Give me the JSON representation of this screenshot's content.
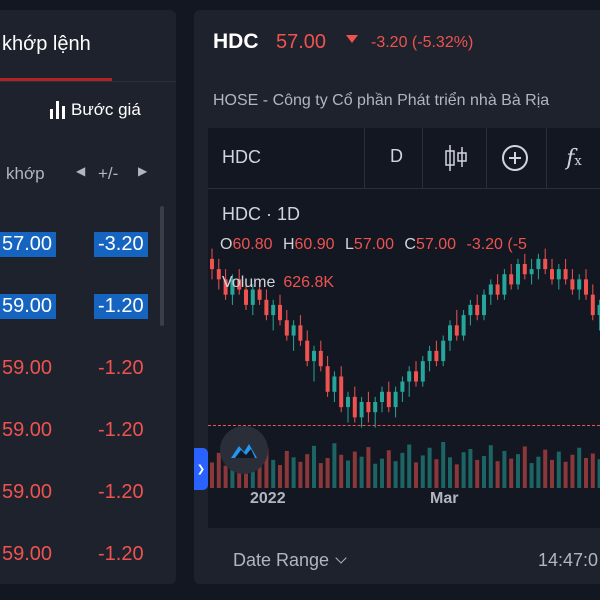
{
  "left_panel": {
    "tab_label": "khớp lệnh",
    "step_button_label": "Bước giá",
    "columns": {
      "matched": "khớp",
      "change": "+/-"
    },
    "rows": [
      {
        "price": "57.00",
        "change": "-3.20",
        "highlight": true
      },
      {
        "price": "59.00",
        "change": "-1.20",
        "highlight": true
      },
      {
        "price": "59.00",
        "change": "-1.20",
        "highlight": false
      },
      {
        "price": "59.00",
        "change": "-1.20",
        "highlight": false
      },
      {
        "price": "59.00",
        "change": "-1.20",
        "highlight": false
      },
      {
        "price": "59.00",
        "change": "-1.20",
        "highlight": false
      }
    ]
  },
  "header": {
    "symbol": "HDC",
    "price": "57.00",
    "change": "-3.20 (-5.32%)",
    "exchange_line": "HOSE - Công ty Cổ phần Phát triển nhà Bà Rịa"
  },
  "chart": {
    "toolbar": {
      "symbol": "HDC",
      "interval": "D"
    },
    "legend_title": "HDC · 1D",
    "ohlc": {
      "o_label": "O",
      "o": "60.80",
      "h_label": "H",
      "h": "60.90",
      "l_label": "L",
      "l": "57.00",
      "c_label": "C",
      "c": "57.00",
      "change": "-3.20 (-5"
    },
    "volume_label": "Volume",
    "volume_value": "626.8K",
    "x_labels": {
      "first": "2022",
      "second": "Mar"
    },
    "footer": {
      "date_range": "Date Range",
      "time": "14:47:0"
    }
  },
  "chart_data": {
    "type": "candlestick",
    "series": [
      {
        "name": "HDC",
        "ohlc": [
          [
            82,
            84,
            78,
            80
          ],
          [
            80,
            82,
            76,
            78
          ],
          [
            78,
            80,
            74,
            75
          ],
          [
            75,
            79,
            73,
            78
          ],
          [
            78,
            80,
            75,
            76
          ],
          [
            76,
            78,
            72,
            73
          ],
          [
            73,
            77,
            71,
            76
          ],
          [
            76,
            78,
            73,
            74
          ],
          [
            74,
            76,
            70,
            71
          ],
          [
            71,
            74,
            68,
            73
          ],
          [
            73,
            75,
            69,
            70
          ],
          [
            70,
            72,
            66,
            67
          ],
          [
            67,
            70,
            64,
            69
          ],
          [
            69,
            71,
            65,
            66
          ],
          [
            66,
            68,
            61,
            62
          ],
          [
            62,
            65,
            58,
            64
          ],
          [
            64,
            66,
            60,
            61
          ],
          [
            61,
            63,
            55,
            56
          ],
          [
            56,
            60,
            54,
            59
          ],
          [
            59,
            61,
            52,
            53
          ],
          [
            53,
            56,
            50,
            55
          ],
          [
            55,
            57,
            50,
            51
          ],
          [
            51,
            55,
            49,
            54
          ],
          [
            54,
            56,
            50,
            52
          ],
          [
            52,
            55,
            49,
            54
          ],
          [
            54,
            57,
            52,
            56
          ],
          [
            56,
            58,
            52,
            53
          ],
          [
            53,
            57,
            51,
            56
          ],
          [
            56,
            59,
            54,
            58
          ],
          [
            58,
            61,
            55,
            60
          ],
          [
            60,
            62,
            57,
            58
          ],
          [
            58,
            63,
            57,
            62
          ],
          [
            62,
            65,
            60,
            64
          ],
          [
            64,
            66,
            61,
            62
          ],
          [
            62,
            67,
            61,
            66
          ],
          [
            66,
            70,
            64,
            69
          ],
          [
            69,
            72,
            66,
            67
          ],
          [
            67,
            72,
            66,
            71
          ],
          [
            71,
            74,
            69,
            73
          ],
          [
            73,
            75,
            70,
            71
          ],
          [
            71,
            76,
            70,
            75
          ],
          [
            75,
            78,
            73,
            77
          ],
          [
            77,
            79,
            74,
            75
          ],
          [
            75,
            80,
            74,
            79
          ],
          [
            79,
            81,
            76,
            77
          ],
          [
            77,
            82,
            76,
            81
          ],
          [
            81,
            83,
            78,
            79
          ],
          [
            79,
            82,
            77,
            80
          ],
          [
            80,
            83,
            78,
            82
          ],
          [
            82,
            84,
            79,
            80
          ],
          [
            80,
            82,
            77,
            78
          ],
          [
            78,
            81,
            76,
            80
          ],
          [
            80,
            82,
            77,
            78
          ],
          [
            78,
            80,
            75,
            76
          ],
          [
            76,
            79,
            74,
            78
          ],
          [
            78,
            80,
            74,
            75
          ],
          [
            75,
            77,
            70,
            71
          ],
          [
            71,
            74,
            68,
            73
          ]
        ]
      }
    ],
    "volume": [
      40,
      55,
      35,
      60,
      45,
      30,
      50,
      38,
      62,
      44,
      36,
      58,
      48,
      41,
      53,
      66,
      39,
      47,
      70,
      52,
      43,
      57,
      49,
      64,
      38,
      46,
      59,
      42,
      55,
      68,
      40,
      51,
      63,
      45,
      72,
      48,
      37,
      56,
      61,
      44,
      50,
      67,
      42,
      58,
      46,
      53,
      65,
      39,
      49,
      60,
      44,
      57,
      41,
      52,
      63,
      47,
      54,
      45
    ],
    "last_close": 57.0
  }
}
